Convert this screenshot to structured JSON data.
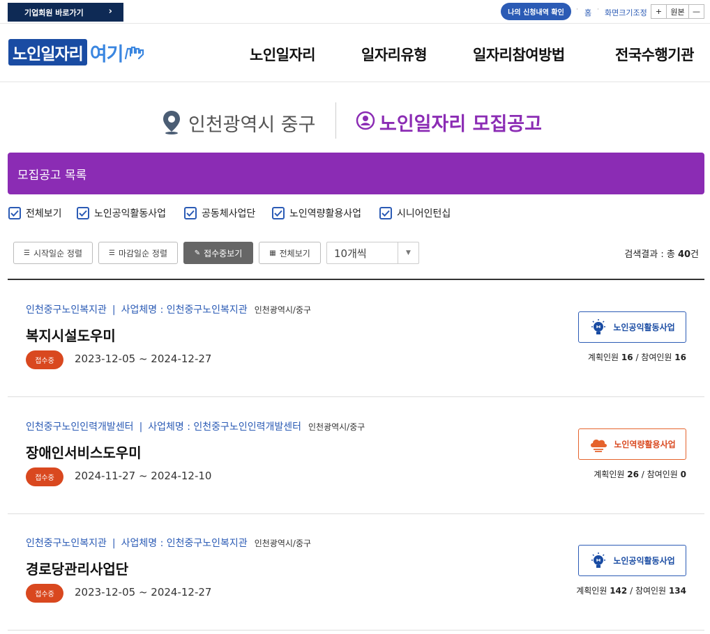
{
  "topbar": {
    "corp_link": "기업회원 바로가기",
    "apply_check": "나의 신청내역 확인",
    "home": "홈",
    "zoom_label": "화면크기조정",
    "zoom_in": "+",
    "zoom_reset": "원본",
    "zoom_out": "—"
  },
  "header": {
    "logo_part1": "노인일자리",
    "logo_part2": "여기",
    "nav": [
      "노인일자리",
      "일자리유형",
      "일자리참여방법",
      "전국수행기관"
    ]
  },
  "location": "인천광역시 중구",
  "page_title": "노인일자리 모집공고",
  "panel_title": "모집공고 목록",
  "filters": [
    "전체보기",
    "노인공익활동사업",
    "공동체사업단",
    "노인역량활용사업",
    "시니어인턴십"
  ],
  "sort_buttons": [
    "시작일순 정렬",
    "마감일순 정렬",
    "접수중보기",
    "전체보기"
  ],
  "page_size": "10개씩",
  "result": {
    "prefix": "검색결과 : 총 ",
    "count": "40",
    "suffix": "건"
  },
  "jobs": [
    {
      "org": "인천중구노인복지관",
      "biz_name": "사업체명 : 인천중구노인복지관",
      "region": "인천광역시/중구",
      "title": "복지시설도우미",
      "status": "접수중",
      "period": "2023-12-05 ~ 2024-12-27",
      "type": "노인공익활동사업",
      "plan_label": "계획인원",
      "plan": "16",
      "join_label": "참여인원",
      "join": "16"
    },
    {
      "org": "인천중구노인인력개발센터",
      "biz_name": "사업체명 : 인천중구노인인력개발센터",
      "region": "인천광역시/중구",
      "title": "장애인서비스도우미",
      "status": "접수중",
      "period": "2024-11-27 ~ 2024-12-10",
      "type": "노인역량활용사업",
      "plan_label": "계획인원",
      "plan": "26",
      "join_label": "참여인원",
      "join": "0"
    },
    {
      "org": "인천중구노인복지관",
      "biz_name": "사업체명 : 인천중구노인복지관",
      "region": "인천광역시/중구",
      "title": "경로당관리사업단",
      "status": "접수중",
      "period": "2023-12-05 ~ 2024-12-27",
      "type": "노인공익활동사업",
      "plan_label": "계획인원",
      "plan": "142",
      "join_label": "참여인원",
      "join": "134"
    }
  ],
  "colors": {
    "purple": "#8b2cb4",
    "navy": "#0e2a55",
    "blue": "#2b5bb5",
    "status_orange": "#d9481f"
  }
}
